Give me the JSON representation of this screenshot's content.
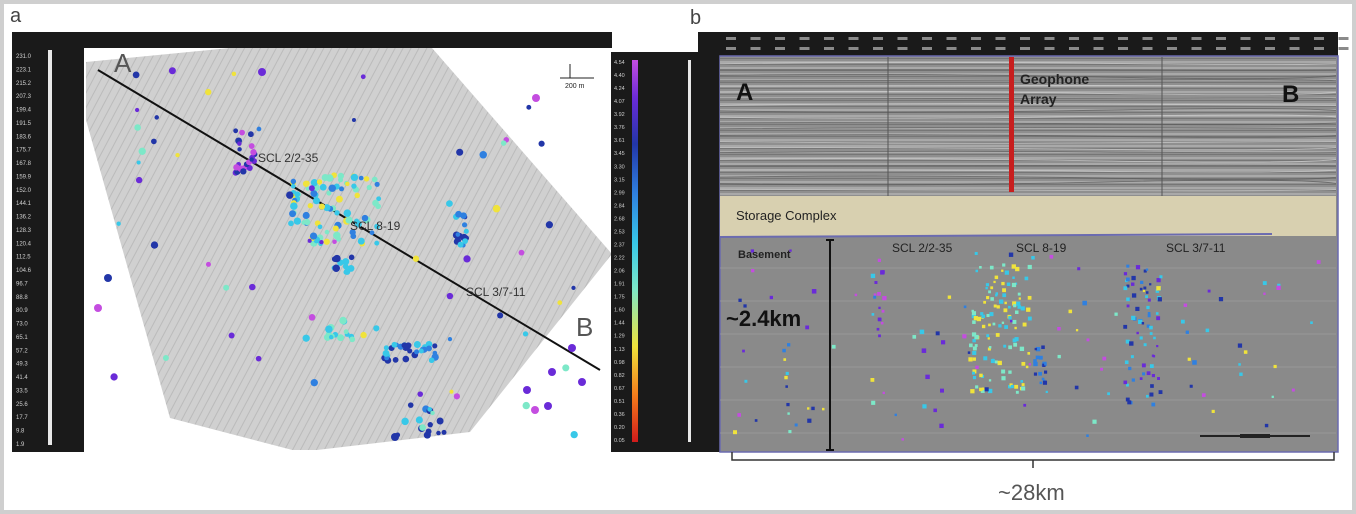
{
  "panels": {
    "a": {
      "label": "a",
      "title_label": "",
      "point_labels": {
        "a": "A",
        "b": "B"
      },
      "well_labels": [
        "SCL 2/2-35",
        "SCL 8-19",
        "SCL 3/7-11"
      ],
      "left_scale_values": [
        "231.0",
        "223.1",
        "215.2",
        "207.3",
        "199.4",
        "191.5",
        "183.6",
        "175.7",
        "167.8",
        "159.9",
        "152.0",
        "144.1",
        "136.2",
        "128.3",
        "120.4",
        "112.5",
        "104.6",
        "96.7",
        "88.8",
        "80.9",
        "73.0",
        "65.1",
        "57.2",
        "49.3",
        "41.4",
        "33.5",
        "25.6",
        "17.7",
        "9.8",
        "1.9"
      ],
      "colorbar_values": [
        "4.54",
        "4.40",
        "4.24",
        "4.07",
        "3.92",
        "3.76",
        "3.61",
        "3.45",
        "3.30",
        "3.15",
        "2.99",
        "2.84",
        "2.68",
        "2.53",
        "2.37",
        "2.22",
        "2.06",
        "1.91",
        "1.75",
        "1.60",
        "1.44",
        "1.29",
        "1.13",
        "0.98",
        "0.82",
        "0.67",
        "0.51",
        "0.36",
        "0.20",
        "0.05"
      ],
      "scale_bar_text": "200 m",
      "colors": {
        "background": "#ffffff",
        "survey": "#d0d0d0",
        "profile_line": "#111111",
        "colorbar_stops": [
          "#d01b1b",
          "#f47a1b",
          "#f0e33b",
          "#7de8c8",
          "#38c8e8",
          "#2f80e0",
          "#2236a8",
          "#6a2bd8",
          "#c44de0"
        ]
      }
    },
    "b": {
      "label": "b",
      "endpoints": {
        "a": "A",
        "b": "B"
      },
      "geophone_label": "Geophone Array",
      "storage_label": "Storage Complex",
      "basement_label": "Basement",
      "well_labels": [
        "SCL 2/2-35",
        "SCL 8-19",
        "SCL 3/7-11"
      ],
      "depth_label": "~2.4km",
      "width_label": "~28km",
      "colors": {
        "section_bg": "#8c8c8c",
        "storage_band": "#d8d0b0",
        "geophone": "#c81e1e",
        "frame_border": "#6b6bb0"
      }
    }
  }
}
